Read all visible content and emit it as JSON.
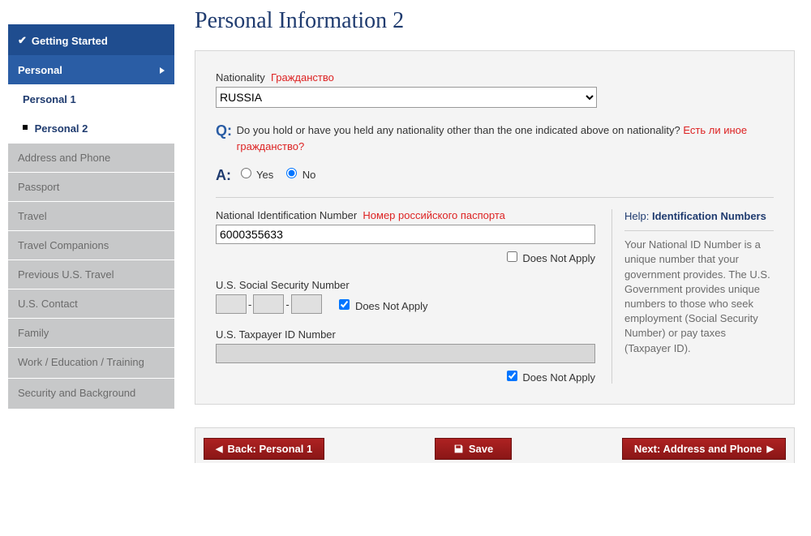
{
  "sidebar": {
    "getting_started": "Getting Started",
    "personal": "Personal",
    "personal1": "Personal 1",
    "personal2": "Personal 2",
    "items": [
      "Address and Phone",
      "Passport",
      "Travel",
      "Travel Companions",
      "Previous U.S. Travel",
      "U.S. Contact",
      "Family",
      "Work / Education / Training",
      "Security and Background"
    ]
  },
  "page_title": "Personal Information 2",
  "nationality": {
    "label": "Nationality",
    "annotation": "Гражданство",
    "value": "RUSSIA"
  },
  "question_other_nat": {
    "q_prefix": "Q:",
    "text": "Do you hold or have you held any nationality other than the one indicated above on nationality?",
    "annotation": "Есть ли иное гражданство?",
    "a_prefix": "A:",
    "opt_yes": "Yes",
    "opt_no": "No",
    "selected": "No"
  },
  "nin": {
    "label": "National Identification Number",
    "annotation": "Номер российского паспорта",
    "value": "6000355633",
    "dna_label": "Does Not Apply",
    "dna_checked": false
  },
  "ssn": {
    "label": "U.S. Social Security Number",
    "dna_label": "Does Not Apply",
    "dna_checked": true
  },
  "tax": {
    "label": "U.S. Taxpayer ID Number",
    "dna_label": "Does Not Apply",
    "dna_checked": true
  },
  "help": {
    "title_prefix": "Help:",
    "title": "Identification Numbers",
    "body": "Your National ID Number is a unique number that your government provides. The U.S. Government provides unique numbers to those who seek employment (Social Security Number) or pay taxes (Taxpayer ID)."
  },
  "buttons": {
    "back": "Back: Personal 1",
    "save": "Save",
    "next": "Next: Address and Phone"
  }
}
